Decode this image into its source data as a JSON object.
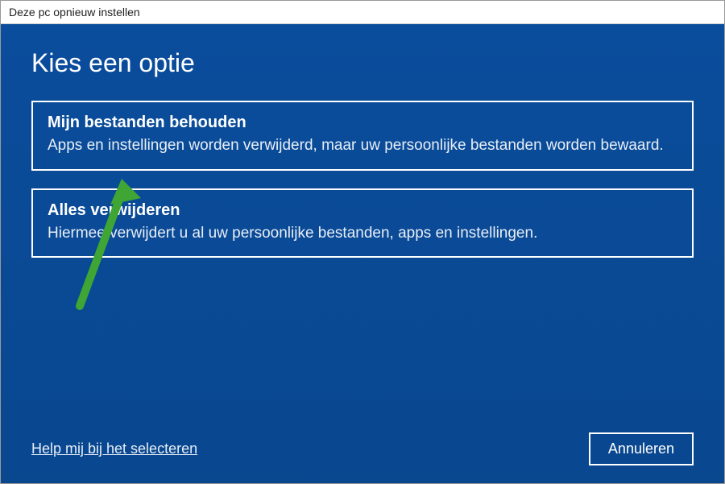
{
  "window": {
    "title": "Deze pc opnieuw instellen"
  },
  "heading": "Kies een optie",
  "options": [
    {
      "title": "Mijn bestanden behouden",
      "desc": "Apps en instellingen worden verwijderd, maar uw persoonlijke bestanden worden bewaard."
    },
    {
      "title": "Alles verwijderen",
      "desc": "Hiermee verwijdert u al uw persoonlijke bestanden, apps en instellingen."
    }
  ],
  "help_link": "Help mij bij het selecteren",
  "cancel_button": "Annuleren",
  "colors": {
    "background": "#0a4b9a",
    "arrow": "#3fa535"
  }
}
